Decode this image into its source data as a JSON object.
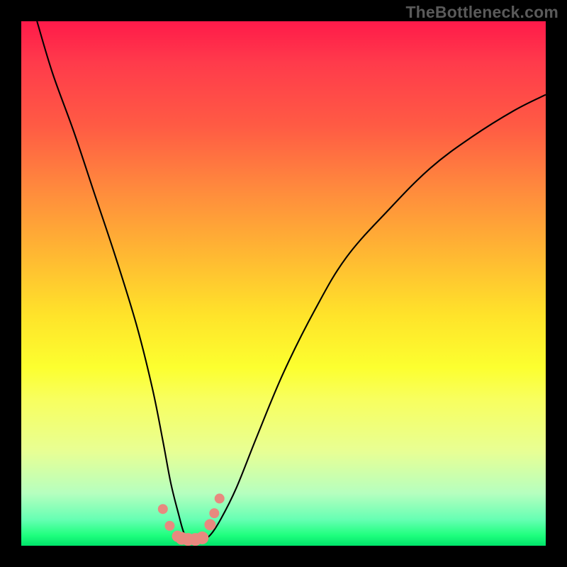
{
  "watermark": "TheBottleneck.com",
  "colors": {
    "frame": "#000000",
    "curve": "#000000",
    "points": "#e8897f",
    "gradient_top": "#ff1a4a",
    "gradient_bottom": "#00e46a"
  },
  "chart_data": {
    "type": "line",
    "title": "",
    "xlabel": "",
    "ylabel": "",
    "xlim": [
      0,
      100
    ],
    "ylim": [
      0,
      100
    ],
    "annotations": [
      "TheBottleneck.com"
    ],
    "legend": false,
    "grid": false,
    "series": [
      {
        "name": "bottleneck-curve",
        "x": [
          3,
          6,
          10,
          14,
          18,
          22,
          25,
          27,
          28.5,
          30,
          31,
          32,
          33,
          34.5,
          36,
          38,
          41,
          45,
          50,
          56,
          62,
          70,
          78,
          86,
          94,
          100
        ],
        "y": [
          100,
          90,
          79,
          67,
          55,
          42,
          30,
          20,
          12,
          6,
          2.5,
          1.3,
          1.0,
          1.2,
          2.0,
          5,
          11,
          21,
          33,
          45,
          55,
          64,
          72,
          78,
          83,
          86
        ]
      }
    ],
    "scatter_points": {
      "name": "highlighted-points",
      "x": [
        27.0,
        28.3,
        29.8,
        30.6,
        31.8,
        33.2,
        34.5,
        36.0,
        36.8,
        37.8
      ],
      "y": [
        7.0,
        3.8,
        1.8,
        1.4,
        1.2,
        1.2,
        1.5,
        4.0,
        6.2,
        9.0
      ],
      "r": [
        7,
        7,
        8,
        9,
        9,
        9,
        9,
        8,
        7,
        7
      ]
    }
  }
}
